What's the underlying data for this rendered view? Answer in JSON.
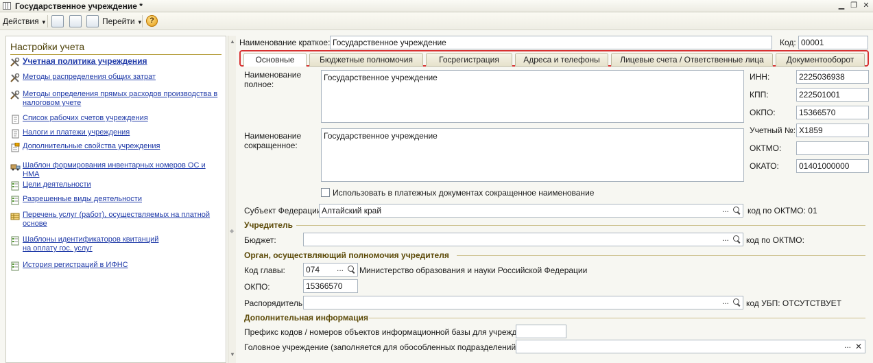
{
  "window": {
    "title": "Государственное учреждение *",
    "min_label": "▁",
    "restore_label": "❐",
    "close_label": "✕"
  },
  "toolbar": {
    "actions_label": "Действия",
    "goto_label": "Перейти",
    "help_label": "?"
  },
  "sidebar": {
    "title": "Настройки учета",
    "items": [
      {
        "label": "Учетная политика учреждения",
        "icon": "tools-icon"
      },
      {
        "label": "Методы распределения общих затрат",
        "icon": "tools-icon"
      },
      {
        "label": "Методы определения прямых расходов производства в",
        "label2": "налоговом учете",
        "icon": "tools-icon"
      },
      {
        "label": "Список рабочих счетов учреждения",
        "icon": "document-icon"
      },
      {
        "label": "Налоги и платежи учреждения",
        "icon": "document-icon"
      },
      {
        "label": "Дополнительные свойства учреждения",
        "icon": "properties-icon"
      },
      {
        "label": "Шаблон формирования инвентарных номеров ОС и НМА",
        "icon": "truck-icon"
      },
      {
        "label": "Цели деятельности",
        "icon": "catalog-icon"
      },
      {
        "label": "Разрешенные виды деятельности",
        "icon": "catalog-icon"
      },
      {
        "label": "Перечень услуг (работ), осуществляемых на платной",
        "label2": "основе",
        "icon": "table-icon"
      },
      {
        "label": "Шаблоны идентификаторов квитанций",
        "label2": "на оплату гос. услуг",
        "icon": "catalog-icon"
      },
      {
        "label": "История регистраций в ИФНС",
        "icon": "catalog-icon"
      }
    ]
  },
  "header": {
    "short_name_label": "Наименование краткое:",
    "short_name_value": "Государственное учреждение",
    "code_label": "Код:",
    "code_value": "00001"
  },
  "tabs": [
    {
      "label": "Основные"
    },
    {
      "label": "Бюджетные полномочия"
    },
    {
      "label": "Госрегистрация"
    },
    {
      "label": "Адреса и телефоны"
    },
    {
      "label": "Лицевые счета / Ответственные лица"
    },
    {
      "label": "Документооборот"
    }
  ],
  "main": {
    "full_name_label_1": "Наименование",
    "full_name_label_2": "полное:",
    "full_name_value": "Государственное учреждение",
    "abbr_name_label_1": "Наименование",
    "abbr_name_label_2": "сокращенное:",
    "abbr_name_value": "Государственное учреждение",
    "use_abbr_label": "Использовать в платежных документах сокращенное наименование",
    "inn_label": "ИНН:",
    "inn_value": "2225036938",
    "kpp_label": "КПП:",
    "kpp_value": "222501001",
    "okpo_label": "ОКПО:",
    "okpo_value": "15366570",
    "reg_label": "Учетный №:",
    "reg_value": "Х1859",
    "oktmo_label": "ОКТМО:",
    "oktmo_value": "",
    "okato_label": "ОКАТО:",
    "okato_value": "01401000000",
    "subject_label": "Субъект Федерации:",
    "subject_value": "Алтайский край",
    "subject_oktmo": "код по ОКТМО: 01",
    "founder_section": "Учредитель",
    "budget_label": "Бюджет:",
    "budget_value": "",
    "budget_oktmo": "код по ОКТМО:",
    "authority_section": "Орган, осуществляющий полномочия учредителя",
    "head_code_label": "Код главы:",
    "head_code_value": "074",
    "head_code_name": "Министерство образования и науки Российской Федерации",
    "okpo2_label": "ОКПО:",
    "okpo2_value": "15366570",
    "manager_label": "Распорядитель:",
    "manager_value": "",
    "manager_ubp": "код УБП: ОТСУТСТВУЕТ",
    "extra_section": "Дополнительная информация",
    "prefix_label": "Префикс кодов / номеров объектов информационной базы для учреждения:",
    "prefix_value": "",
    "parent_label": "Головное учреждение (заполняется для обособленных подразделений):",
    "parent_value": ""
  },
  "common": {
    "dots": "...",
    "x": "✕"
  },
  "colors": {
    "link": "#1f3aa8",
    "section": "#5c4a08",
    "tabs_highlight": "#d83030"
  }
}
